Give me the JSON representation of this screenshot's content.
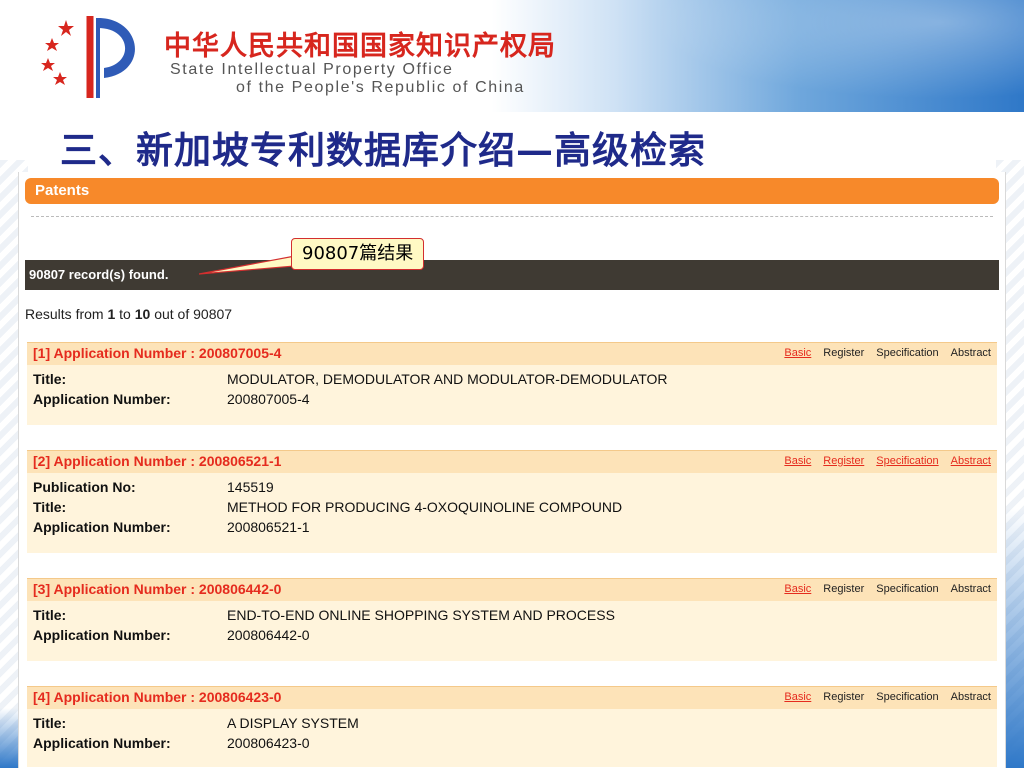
{
  "org": {
    "name_cn": "中华人民共和国国家知识产权局",
    "name_en_line1": "State Intellectual Property Office",
    "name_en_line2": "of the People's Republic of China"
  },
  "slide_title": "三、新加坡专利数据库介绍—高级检索",
  "page": {
    "section_title": "Patents",
    "records_found": "90807 record(s) found.",
    "callout": "90807篇结果",
    "results_prefix": "Results from ",
    "results_from": "1",
    "results_to_word": " to ",
    "results_to": "10",
    "results_outof": " out of 90807"
  },
  "link_labels": {
    "basic": "Basic",
    "register": "Register",
    "specification": "Specification",
    "abstract": "Abstract"
  },
  "field_labels": {
    "publication_no": "Publication No:",
    "title": "Title:",
    "application_number": "Application Number:"
  },
  "results": [
    {
      "header": "[1] Application Number : 200807005-4",
      "title": "MODULATOR, DEMODULATOR AND MODULATOR-DEMODULATOR",
      "application_number": "200807005-4",
      "links_active": [
        "basic"
      ]
    },
    {
      "header": "[2] Application Number : 200806521-1",
      "publication_no": "145519",
      "title": "METHOD FOR PRODUCING 4-OXOQUINOLINE COMPOUND",
      "application_number": "200806521-1",
      "links_active": [
        "basic",
        "register",
        "specification",
        "abstract"
      ]
    },
    {
      "header": "[3] Application Number : 200806442-0",
      "title": "END-TO-END ONLINE SHOPPING SYSTEM AND PROCESS",
      "application_number": "200806442-0",
      "links_active": [
        "basic"
      ]
    },
    {
      "header": "[4] Application Number : 200806423-0",
      "title": "A DISPLAY SYSTEM",
      "application_number": "200806423-0",
      "links_active": [
        "basic"
      ]
    }
  ],
  "colors": {
    "accent_orange": "#f7892a",
    "record_red": "#e52b1e",
    "title_blue": "#1f2a8a",
    "org_red": "#d7261e"
  }
}
